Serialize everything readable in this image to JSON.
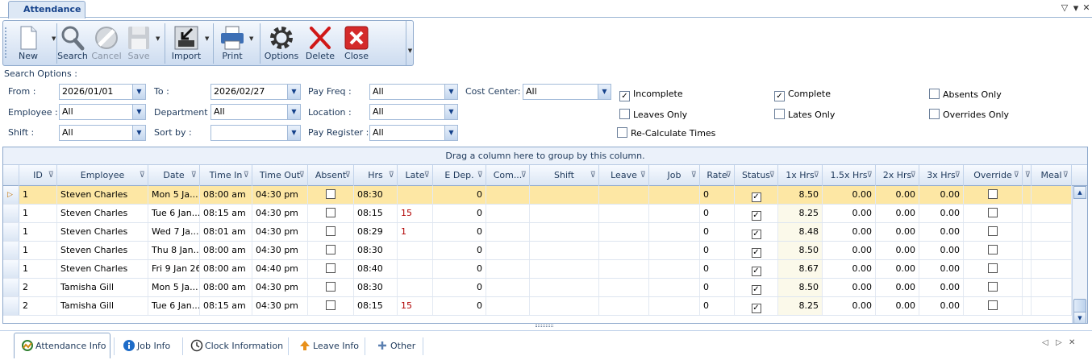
{
  "window": {
    "tab_title": "Attendance",
    "controls": {
      "dropdown": "▽",
      "minimize": "▾",
      "close": "✕"
    }
  },
  "toolbar": {
    "buttons": [
      {
        "id": "new",
        "label": "New",
        "icon": "new-document-icon",
        "enabled": true,
        "dropdown": true
      },
      {
        "id": "search",
        "label": "Search",
        "icon": "magnifier-icon",
        "enabled": true
      },
      {
        "id": "cancel",
        "label": "Cancel",
        "icon": "cancel-icon",
        "enabled": false
      },
      {
        "id": "save",
        "label": "Save",
        "icon": "floppy-disk-icon",
        "enabled": false,
        "dropdown": true
      },
      {
        "id": "import",
        "label": "Import",
        "icon": "import-icon",
        "enabled": true,
        "dropdown": true
      },
      {
        "id": "print",
        "label": "Print",
        "icon": "printer-icon",
        "enabled": true,
        "dropdown": true
      },
      {
        "id": "options",
        "label": "Options",
        "icon": "gear-icon",
        "enabled": true
      },
      {
        "id": "delete",
        "label": "Delete",
        "icon": "red-x-icon",
        "enabled": true
      },
      {
        "id": "close",
        "label": "Close",
        "icon": "close-box-icon",
        "enabled": true
      }
    ]
  },
  "search": {
    "title": "Search Options :",
    "from_label": "From :",
    "from_value": "2026/01/01",
    "to_label": "To :",
    "to_value": "2026/02/27",
    "payfreq_label": "Pay Freq :",
    "payfreq_value": "All",
    "costcenter_label": "Cost Center:",
    "costcenter_value": "All",
    "employee_label": "Employee :",
    "employee_value": "All",
    "department_label": "Department :",
    "department_value": "All",
    "location_label": "Location :",
    "location_value": "All",
    "shift_label": "Shift :",
    "shift_value": "All",
    "sortby_label": "Sort by :",
    "sortby_value": "",
    "payregister_label": "Pay Register :",
    "payregister_value": "All",
    "checks": {
      "incomplete": {
        "label": "Incomplete",
        "checked": true
      },
      "complete": {
        "label": "Complete",
        "checked": true
      },
      "absents_only": {
        "label": "Absents Only",
        "checked": false
      },
      "leaves_only": {
        "label": "Leaves Only",
        "checked": false
      },
      "lates_only": {
        "label": "Lates Only",
        "checked": false
      },
      "overrides_only": {
        "label": "Overrides Only",
        "checked": false
      },
      "recalc": {
        "label": "Re-Calculate Times",
        "checked": false
      }
    }
  },
  "grid": {
    "group_hint": "Drag a column here to group by this column.",
    "columns": [
      "ID",
      "Employee",
      "Date",
      "Time In",
      "Time Out",
      "Absent",
      "Hrs",
      "Late",
      "E Dep.",
      "Com...",
      "Shift",
      "Leave",
      "Job",
      "Rate",
      "Status",
      "1x Hrs",
      "1.5x Hrs",
      "2x Hrs",
      "3x Hrs",
      "Override",
      "",
      "Meal"
    ],
    "rows": [
      {
        "id": "1",
        "employee": "Steven Charles",
        "date": "Mon 5 Ja...",
        "time_in": "08:00 am",
        "time_out": "04:30 pm",
        "absent": false,
        "hrs": "08:30",
        "late": "",
        "e_dep": "0",
        "com": "",
        "shift": "",
        "leave": "",
        "job": "",
        "rate": "0",
        "status": true,
        "h1": "8.50",
        "h15": "0.00",
        "h2": "0.00",
        "h3": "0.00",
        "override": false,
        "selected": true
      },
      {
        "id": "1",
        "employee": "Steven Charles",
        "date": "Tue 6 Jan...",
        "time_in": "08:15 am",
        "time_out": "04:30 pm",
        "absent": false,
        "hrs": "08:15",
        "late": "15",
        "e_dep": "0",
        "com": "",
        "shift": "",
        "leave": "",
        "job": "",
        "rate": "0",
        "status": true,
        "h1": "8.25",
        "h15": "0.00",
        "h2": "0.00",
        "h3": "0.00",
        "override": false,
        "selected": false
      },
      {
        "id": "1",
        "employee": "Steven Charles",
        "date": "Wed 7 Ja...",
        "time_in": "08:01 am",
        "time_out": "04:30 pm",
        "absent": false,
        "hrs": "08:29",
        "late": "1",
        "e_dep": "0",
        "com": "",
        "shift": "",
        "leave": "",
        "job": "",
        "rate": "0",
        "status": true,
        "h1": "8.48",
        "h15": "0.00",
        "h2": "0.00",
        "h3": "0.00",
        "override": false,
        "selected": false
      },
      {
        "id": "1",
        "employee": "Steven Charles",
        "date": "Thu 8 Jan...",
        "time_in": "08:00 am",
        "time_out": "04:30 pm",
        "absent": false,
        "hrs": "08:30",
        "late": "",
        "e_dep": "0",
        "com": "",
        "shift": "",
        "leave": "",
        "job": "",
        "rate": "0",
        "status": true,
        "h1": "8.50",
        "h15": "0.00",
        "h2": "0.00",
        "h3": "0.00",
        "override": false,
        "selected": false
      },
      {
        "id": "1",
        "employee": "Steven Charles",
        "date": "Fri 9 Jan 26",
        "time_in": "08:00 am",
        "time_out": "04:40 pm",
        "absent": false,
        "hrs": "08:40",
        "late": "",
        "e_dep": "0",
        "com": "",
        "shift": "",
        "leave": "",
        "job": "",
        "rate": "0",
        "status": true,
        "h1": "8.67",
        "h15": "0.00",
        "h2": "0.00",
        "h3": "0.00",
        "override": false,
        "selected": false
      },
      {
        "id": "2",
        "employee": "Tamisha Gill",
        "date": "Mon 5 Ja...",
        "time_in": "08:00 am",
        "time_out": "04:30 pm",
        "absent": false,
        "hrs": "08:30",
        "late": "",
        "e_dep": "0",
        "com": "",
        "shift": "",
        "leave": "",
        "job": "",
        "rate": "0",
        "status": true,
        "h1": "8.50",
        "h15": "0.00",
        "h2": "0.00",
        "h3": "0.00",
        "override": false,
        "selected": false
      },
      {
        "id": "2",
        "employee": "Tamisha Gill",
        "date": "Tue 6 Jan...",
        "time_in": "08:15 am",
        "time_out": "04:30 pm",
        "absent": false,
        "hrs": "08:15",
        "late": "15",
        "e_dep": "0",
        "com": "",
        "shift": "",
        "leave": "",
        "job": "",
        "rate": "0",
        "status": true,
        "h1": "8.25",
        "h15": "0.00",
        "h2": "0.00",
        "h3": "0.00",
        "override": false,
        "selected": false
      }
    ]
  },
  "bottom_tabs": [
    {
      "label": "Attendance  Info",
      "icon": "attendance-icon",
      "active": true
    },
    {
      "label": "Job Info",
      "icon": "info-icon",
      "active": false
    },
    {
      "label": "Clock Information",
      "icon": "clock-icon",
      "active": false
    },
    {
      "label": "Leave Info",
      "icon": "leave-icon",
      "active": false
    },
    {
      "label": "Other",
      "icon": "plus-icon",
      "active": false
    }
  ],
  "bottom_nav": {
    "prev": "◁",
    "next": "▷",
    "close": "✕"
  }
}
